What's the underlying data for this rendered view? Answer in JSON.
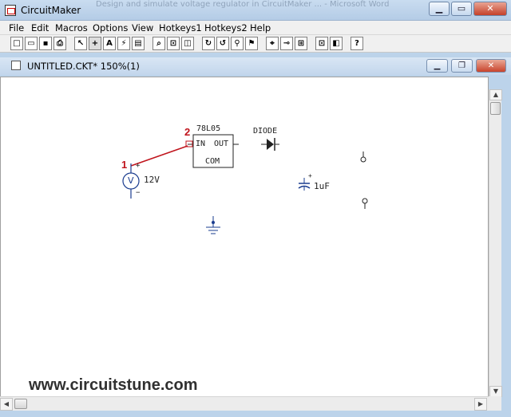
{
  "app": {
    "title": "CircuitMaker",
    "background_title": "Design and simulate voltage regulator in CircuitMaker ... - Microsoft Word"
  },
  "menu": [
    {
      "label": "File"
    },
    {
      "label": "Edit"
    },
    {
      "label": "Macros"
    },
    {
      "label": "Options"
    },
    {
      "label": "View"
    },
    {
      "label": "Hotkeys1"
    },
    {
      "label": "Hotkeys2"
    },
    {
      "label": "Help"
    }
  ],
  "toolbar": {
    "buttons": [
      {
        "name": "new-icon",
        "glyph": "□"
      },
      {
        "name": "open-icon",
        "glyph": "▭"
      },
      {
        "name": "save-icon",
        "glyph": "▪"
      },
      {
        "name": "print-icon",
        "glyph": "⎙"
      },
      {
        "name": "arrow-tool-icon",
        "glyph": "↖"
      },
      {
        "name": "wire-tool-icon",
        "glyph": "+"
      },
      {
        "name": "text-tool-icon",
        "glyph": "A"
      },
      {
        "name": "probe-tool-icon",
        "glyph": "⚡"
      },
      {
        "name": "delete-tool-icon",
        "glyph": "▤"
      },
      {
        "name": "zoom-icon",
        "glyph": "⌕"
      },
      {
        "name": "rotate-icon",
        "glyph": "⊡"
      },
      {
        "name": "mirror-icon",
        "glyph": "◫"
      },
      {
        "name": "reset-icon",
        "glyph": "↻"
      },
      {
        "name": "step-icon",
        "glyph": "↺"
      },
      {
        "name": "walk-icon",
        "glyph": "⚲"
      },
      {
        "name": "run-icon",
        "glyph": "⚑"
      },
      {
        "name": "trace-icon",
        "glyph": "⌖"
      },
      {
        "name": "probe-icon",
        "glyph": "⊸"
      },
      {
        "name": "grid-icon",
        "glyph": "⊞"
      },
      {
        "name": "device-icon",
        "glyph": "⊡"
      },
      {
        "name": "macro-icon",
        "glyph": "◧"
      },
      {
        "name": "help-icon",
        "glyph": "?"
      }
    ]
  },
  "document": {
    "title": "UNTITLED.CKT* 150%(1)"
  },
  "schematic": {
    "regulator": {
      "part": "78L05",
      "pin_in": "IN",
      "pin_out": "OUT",
      "pin_com": "COM"
    },
    "battery": {
      "value": "12V",
      "symbol": "V",
      "plus": "+",
      "minus": "−"
    },
    "diode": {
      "label": "DIODE"
    },
    "capacitor": {
      "value": "1uF",
      "plus": "+"
    },
    "markers": {
      "m1": "1",
      "m2": "2"
    }
  },
  "watermark": "www.circuitstune.com",
  "colors": {
    "wire_red": "#c0141c",
    "component_blue": "#1a3c8f",
    "marker_red": "#c0141c"
  }
}
